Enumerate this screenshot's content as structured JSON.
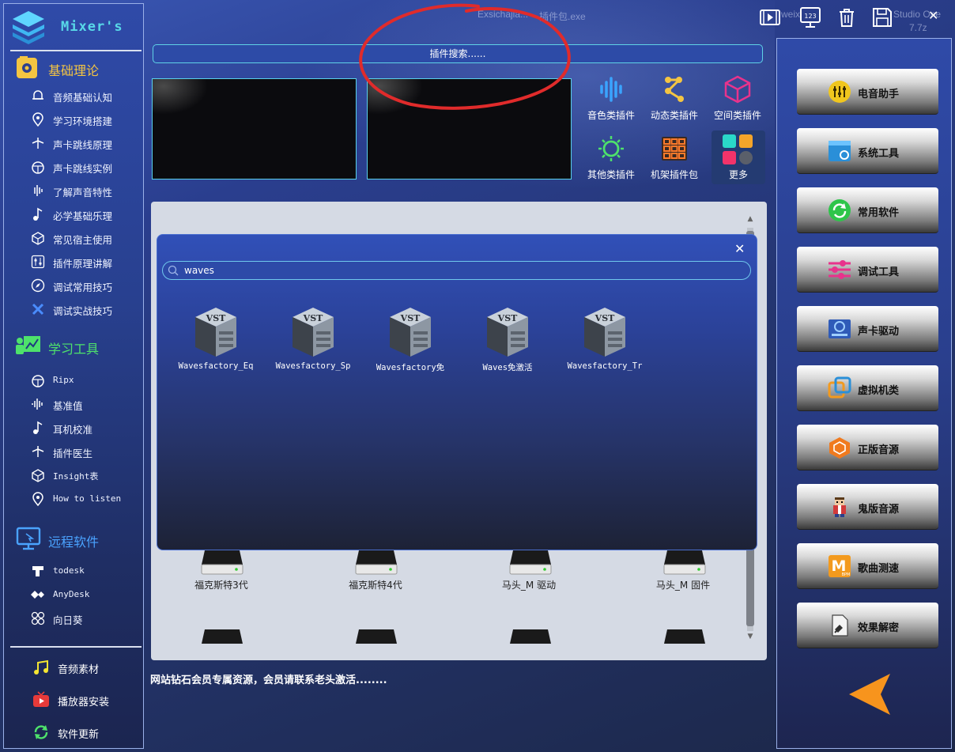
{
  "app": {
    "title": "Mixer's"
  },
  "ghost_titles": [
    "Exsichajia...",
    "插件包.exe",
    "Studio One",
    "7.7z",
    "weixi"
  ],
  "sidebar": {
    "sections": [
      {
        "title": "基础理论",
        "items": [
          "音频基础认知",
          "学习环境搭建",
          "声卡跳线原理",
          "声卡跳线实例",
          "了解声音特性",
          "必学基础乐理",
          "常见宿主使用",
          "插件原理讲解",
          "调试常用技巧",
          "调试实战技巧"
        ]
      },
      {
        "title": "学习工具",
        "items": [
          "Ripx",
          "基准值",
          "耳机校准",
          "插件医生",
          "Insight表",
          "How to listen"
        ]
      },
      {
        "title": "远程软件",
        "items": [
          "todesk",
          "AnyDesk",
          "向日葵"
        ]
      }
    ],
    "bottom": [
      "音频素材",
      "播放器安装",
      "软件更新"
    ]
  },
  "toolbar": {
    "close": "✕"
  },
  "search": {
    "placeholder": "插件搜索......"
  },
  "categories": [
    "音色类插件",
    "动态类插件",
    "空间类插件",
    "其他类插件",
    "机架插件包",
    "更多"
  ],
  "drives": {
    "row": [
      "福克斯特3代",
      "福克斯特4代",
      "马头_M 驱动",
      "马头_M 固件"
    ]
  },
  "popup": {
    "close": "✕",
    "search_value": "waves",
    "results": [
      "Wavesfactory_Eq",
      "Wavesfactory_Sp",
      "Wavesfactory免",
      "Waves免激活",
      "Wavesfactory_Tr"
    ]
  },
  "notice": "网站钻石会员专属资源，会员请联系老头激活........",
  "right_panel": {
    "buttons": [
      "电音助手",
      "系统工具",
      "常用软件",
      "调试工具",
      "声卡驱动",
      "虚拟机类",
      "正版音源",
      "鬼版音源",
      "歌曲测速",
      "效果解密"
    ]
  },
  "colors": {
    "accent": "#58d8e8",
    "section_yellow": "#f4c542",
    "section_green": "#4ee26b",
    "section_blue": "#4aa3ff",
    "annotation_red": "#e02b2b"
  }
}
